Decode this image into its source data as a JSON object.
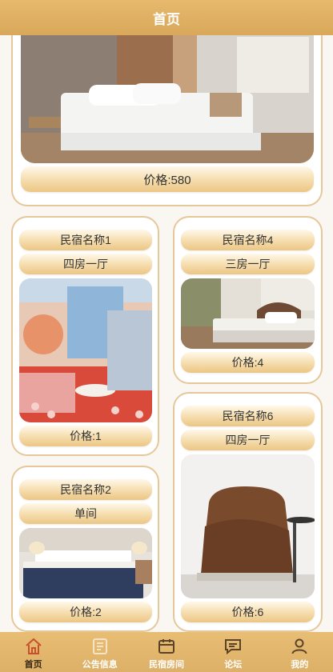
{
  "header": {
    "title": "首页"
  },
  "top_card": {
    "price": "价格:580"
  },
  "listings": [
    {
      "name": "民宿名称1",
      "type": "四房一厅",
      "price": "价格:1"
    },
    {
      "name": "民宿名称4",
      "type": "三房一厅",
      "price": "价格:4"
    },
    {
      "name": "民宿名称6",
      "type": "四房一厅",
      "price": "价格:6"
    },
    {
      "name": "民宿名称2",
      "type": "单间",
      "price": "价格:2"
    }
  ],
  "tabbar": {
    "items": [
      {
        "label": "首页",
        "icon": "home-icon",
        "active": true
      },
      {
        "label": "公告信息",
        "icon": "notice-icon",
        "active": false
      },
      {
        "label": "民宿房间",
        "icon": "room-icon",
        "active": false
      },
      {
        "label": "论坛",
        "icon": "forum-icon",
        "active": false
      },
      {
        "label": "我的",
        "icon": "user-icon",
        "active": false
      }
    ]
  },
  "colors": {
    "accent": "#e0b46a",
    "border": "#e5c89a",
    "active_icon": "#c8502a"
  }
}
